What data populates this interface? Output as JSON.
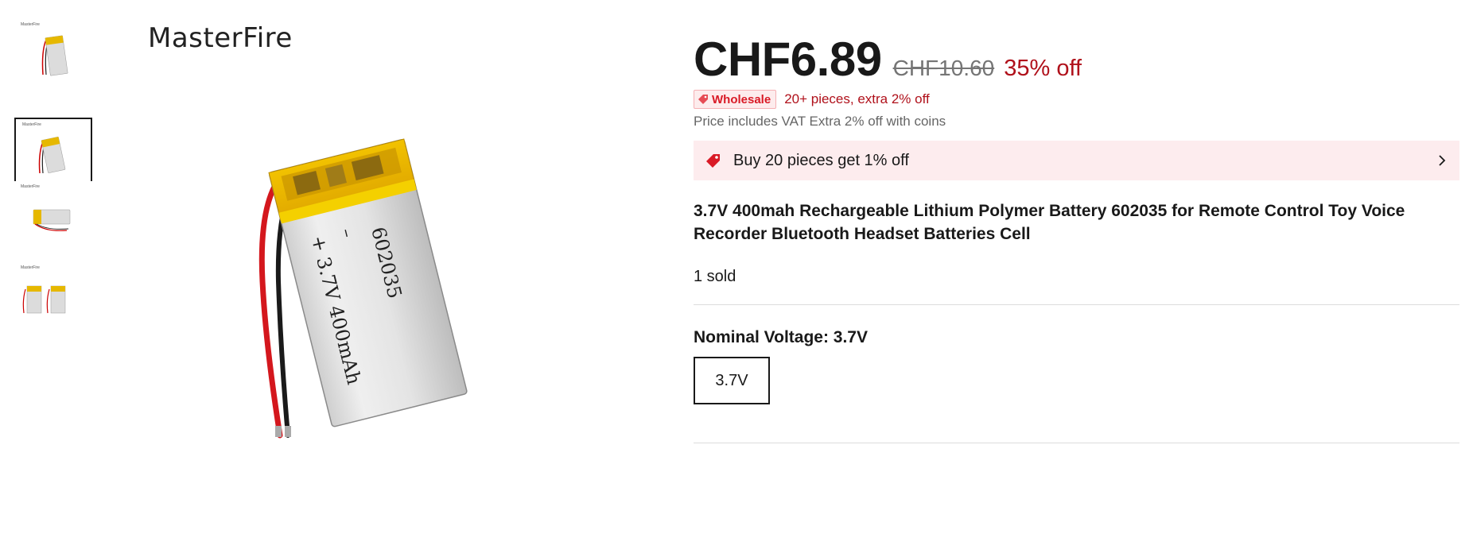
{
  "brand": {
    "name": "MasterFire"
  },
  "thumbnails": [
    {
      "label": "MasterFire",
      "selected": false
    },
    {
      "label": "MasterFire",
      "selected": true
    },
    {
      "label": "MasterFire",
      "selected": false
    },
    {
      "label": "MasterFire",
      "selected": false
    }
  ],
  "main_image": {
    "battery_text_line1": "602035",
    "battery_text_line2": "+ 3.7V 400mAh",
    "battery_minus": "–"
  },
  "price": {
    "current": "CHF6.89",
    "original": "CHF10.60",
    "discount": "35% off"
  },
  "wholesale": {
    "badge": "Wholesale",
    "text": "20+ pieces, extra 2% off"
  },
  "vat_note": "Price includes VAT Extra 2% off with coins",
  "promo": {
    "label": "Buy 20 pieces get 1% off",
    "icon": "tag-icon",
    "chevron": "chevron-right-icon"
  },
  "product": {
    "title": "3.7V 400mah Rechargeable Lithium Polymer Battery 602035 for Remote Control Toy Voice Recorder Bluetooth Headset Batteries Cell",
    "sold": "1 sold"
  },
  "variant": {
    "label": "Nominal Voltage: 3.7V",
    "options": [
      "3.7V"
    ]
  },
  "colors": {
    "accent_red": "#b0111b",
    "badge_red": "#d91a26",
    "promo_bg": "#fdecee",
    "battery_yellow": "#e6b800"
  }
}
